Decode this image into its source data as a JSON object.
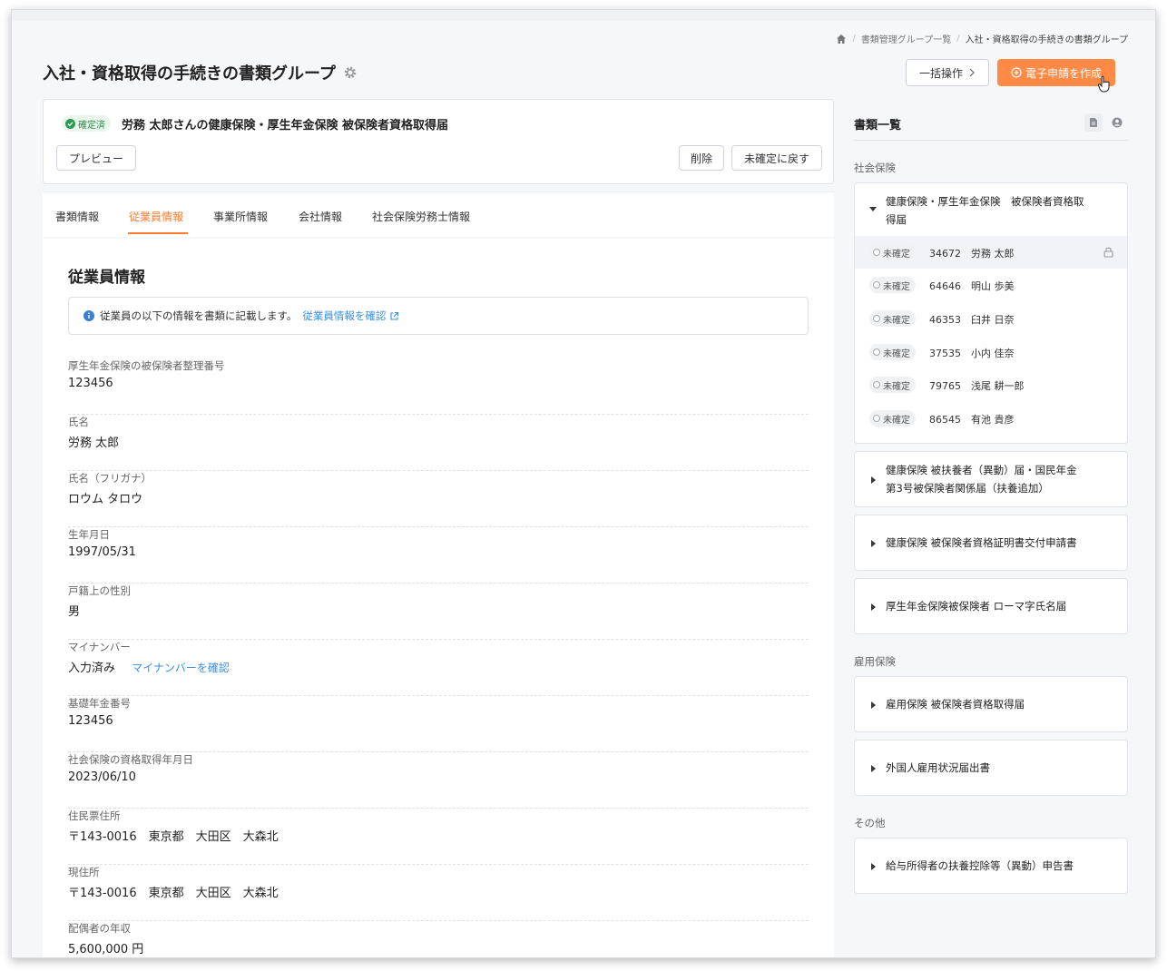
{
  "breadcrumb": {
    "items": [
      "書類管理グループ一覧",
      "入社・資格取得の手続きの書類グループ"
    ]
  },
  "page": {
    "title": "入社・資格取得の手続きの書類グループ"
  },
  "header_actions": {
    "bulk_label": "一括操作",
    "create_label": "電子申請を作成"
  },
  "doc": {
    "status": "確定済",
    "name": "労務 太郎さんの健康保険・厚生年金保険 被保険者資格取得届",
    "preview_label": "プレビュー",
    "delete_label": "削除",
    "revert_label": "未確定に戻す"
  },
  "tabs": [
    "書類情報",
    "従業員情報",
    "事業所情報",
    "会社情報",
    "社会保険労務士情報"
  ],
  "active_tab": "従業員情報",
  "section": {
    "title": "従業員情報",
    "info_text": "従業員の以下の情報を書類に記載します。",
    "info_link": "従業員情報を確認"
  },
  "fields": [
    {
      "label": "厚生年金保険の被保険者整理番号",
      "value": "123456"
    },
    {
      "label": "氏名",
      "value": "労務 太郎"
    },
    {
      "label": "氏名（フリガナ）",
      "value": "ロウム タロウ"
    },
    {
      "label": "生年月日",
      "value": "1997/05/31"
    },
    {
      "label": "戸籍上の性別",
      "value": "男"
    },
    {
      "label": "マイナンバー",
      "value": "入力済み",
      "link": "マイナンバーを確認"
    },
    {
      "label": "基礎年金番号",
      "value": "123456"
    },
    {
      "label": "社会保険の資格取得年月日",
      "value": "2023/06/10"
    },
    {
      "label": "住民票住所",
      "value": "〒143-0016　東京都　大田区　大森北"
    },
    {
      "label": "現住所",
      "value": "〒143-0016　東京都　大田区　大森北"
    },
    {
      "label": "配偶者の年収",
      "value": "5,600,000 円"
    }
  ],
  "sidebar": {
    "title": "書類一覧",
    "categories": [
      {
        "label": "社会保険"
      },
      {
        "label": "雇用保険"
      },
      {
        "label": "その他"
      }
    ],
    "groups": [
      {
        "title_lines": [
          "健康保険・厚生年金保険　被保険者資格取",
          "得届"
        ]
      },
      {
        "title_lines": [
          "健康保険 被扶養者（異動）届・国民年金",
          "第3号被保険者関係届（扶養追加）"
        ]
      },
      {
        "title_lines": [
          "健康保険 被保険者資格証明書交付申請書"
        ]
      },
      {
        "title_lines": [
          "厚生年金保険被保険者 ローマ字氏名届"
        ]
      },
      {
        "title_lines": [
          "雇用保険 被保険者資格取得届"
        ]
      },
      {
        "title_lines": [
          "外国人雇用状況届出書"
        ]
      },
      {
        "title_lines": [
          "給与所得者の扶養控除等（異動）申告書"
        ]
      }
    ],
    "employees": [
      {
        "status": "未確定",
        "text": "34672　労務 太郎"
      },
      {
        "status": "未確定",
        "text": "64646　明山 歩美"
      },
      {
        "status": "未確定",
        "text": "46353　臼井 日奈"
      },
      {
        "status": "未確定",
        "text": "37535　小内 佳奈"
      },
      {
        "status": "未確定",
        "text": "79765　浅尾 耕一郎"
      },
      {
        "status": "未確定",
        "text": "86545　有池 貴彦"
      }
    ]
  },
  "colors": {
    "accent": "#ff8a45",
    "link": "#3a8ee6",
    "success": "#2a8a4a"
  }
}
